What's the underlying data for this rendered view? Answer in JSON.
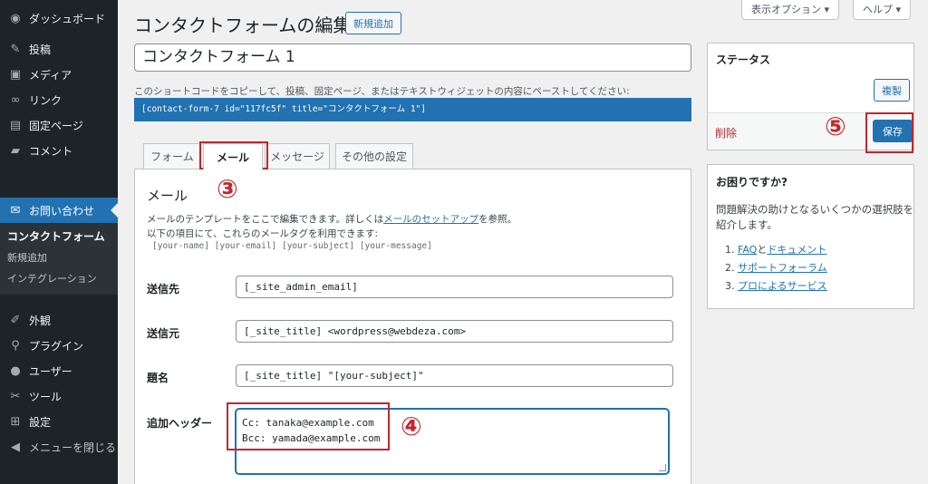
{
  "sidebar": {
    "items": [
      {
        "icon": "dashboard-icon",
        "glyph": "◉",
        "label": "ダッシュボード"
      },
      {
        "icon": "pin-icon",
        "glyph": "✎",
        "label": "投稿"
      },
      {
        "icon": "media-icon",
        "glyph": "▣",
        "label": "メディア"
      },
      {
        "icon": "link-icon",
        "glyph": "∞",
        "label": "リンク"
      },
      {
        "icon": "page-icon",
        "glyph": "▤",
        "label": "固定ページ"
      },
      {
        "icon": "comment-icon",
        "glyph": "▰",
        "label": "コメント"
      }
    ],
    "active": {
      "icon": "mail-icon",
      "glyph": "✉",
      "label": "お問い合わせ"
    },
    "submenu": [
      "コンタクトフォーム",
      "新規追加",
      "インテグレーション"
    ],
    "items2": [
      {
        "icon": "appearance-icon",
        "glyph": "✐",
        "label": "外観"
      },
      {
        "icon": "plugin-icon",
        "glyph": "⚲",
        "label": "プラグイン"
      },
      {
        "icon": "user-icon",
        "glyph": "●",
        "label": "ユーザー"
      },
      {
        "icon": "tools-icon",
        "glyph": "✂",
        "label": "ツール"
      },
      {
        "icon": "settings-icon",
        "glyph": "⊞",
        "label": "設定"
      },
      {
        "icon": "collapse-icon",
        "glyph": "◀",
        "label": "メニューを閉じる"
      }
    ]
  },
  "topbar": {
    "screen_options": "表示オプション ▾",
    "help": "ヘルプ ▾"
  },
  "header": {
    "title": "コンタクトフォームの編集",
    "add_new": "新規追加"
  },
  "form": {
    "title_value": "コンタクトフォーム 1",
    "shortcode_desc": "このショートコードをコピーして、投稿、固定ページ、またはテキストウィジェットの内容にペーストしてください:",
    "shortcode": "[contact-form-7 id=\"117fc5f\" title=\"コンタクトフォーム 1\"]"
  },
  "tabs": [
    "フォーム",
    "メール",
    "メッセージ",
    "その他の設定"
  ],
  "mail": {
    "heading": "メール",
    "desc1_prefix": "メールのテンプレートをここで編集できます。詳しくは",
    "desc1_link": "メールのセットアップ",
    "desc1_suffix": "を参照。",
    "desc2": "以下の項目にて、これらのメールタグを利用できます:",
    "tags": "[your-name] [your-email] [your-subject] [your-message]",
    "fields": {
      "to": {
        "label": "送信先",
        "value": "[_site_admin_email]"
      },
      "from": {
        "label": "送信元",
        "value": "[_site_title] <wordpress@webdeza.com>"
      },
      "subject": {
        "label": "題名",
        "value": "[_site_title] \"[your-subject]\""
      },
      "headers": {
        "label": "追加ヘッダー",
        "line1": "Cc: tanaka@example.com",
        "line2": "Bcc: yamada@example.com"
      }
    }
  },
  "status": {
    "title": "ステータス",
    "duplicate": "複製",
    "delete": "削除",
    "save": "保存"
  },
  "help": {
    "title": "お困りですか?",
    "text1": "問題解決の助けとなるいくつかの選択肢を",
    "text2": "紹介します。",
    "items": [
      {
        "num": "1.",
        "link1": "FAQ",
        "mid": "と",
        "link2": "ドキュメント"
      },
      {
        "num": "2.",
        "link1": "サポートフォーラム"
      },
      {
        "num": "3.",
        "link1": "プロによるサービス"
      }
    ]
  },
  "annotations": {
    "n3": "③",
    "n4": "④",
    "n5": "⑤"
  },
  "colors": {
    "accent": "#2271b1",
    "annotation": "#c0262d",
    "sidebar": "#1d2327"
  }
}
